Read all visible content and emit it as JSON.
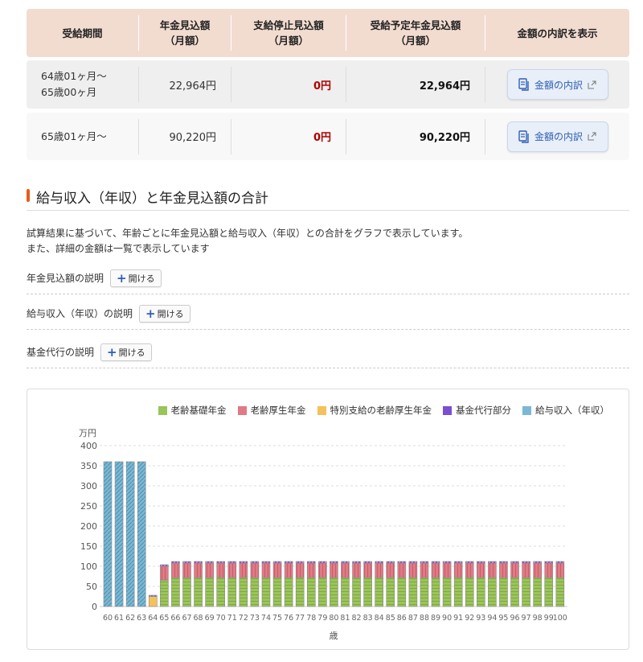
{
  "table": {
    "headers": [
      "受給期間",
      "年金見込額\n（月額）",
      "支給停止見込額\n（月額）",
      "受給予定年金見込額\n（月額）",
      "金額の内訳を表示"
    ],
    "header_lines": [
      [
        "受給期間"
      ],
      [
        "年金見込額",
        "（月額）"
      ],
      [
        "支給停止見込額",
        "（月額）"
      ],
      [
        "受給予定年金見込額",
        "（月額）"
      ],
      [
        "金額の内訳を表示"
      ]
    ],
    "rows": [
      {
        "period_lines": [
          "64歳01ヶ月〜",
          "65歳00ヶ月"
        ],
        "amount": "22,964円",
        "stopped": "0円",
        "scheduled": "22,964円",
        "button": "金額の内訳"
      },
      {
        "period_lines": [
          "65歳01ヶ月〜"
        ],
        "amount": "90,220円",
        "stopped": "0円",
        "scheduled": "90,220円",
        "button": "金額の内訳"
      }
    ]
  },
  "section": {
    "title": "給与収入（年収）と年金見込額の合計",
    "desc1": "試算結果に基づいて、年齢ごとに年金見込額と給与収入（年収）との合計をグラフで表示しています。",
    "desc2": "また、詳細の金額は一覧で表示しています",
    "accordions": [
      {
        "label": "年金見込額の説明",
        "button": "開ける"
      },
      {
        "label": "給与収入（年収）の説明",
        "button": "開ける"
      },
      {
        "label": "基金代行の説明",
        "button": "開ける"
      }
    ]
  },
  "colors": {
    "accent": "#e85a1b",
    "basic": "#9bc45a",
    "employee": "#e07a85",
    "special": "#f5c15a",
    "fund": "#7a4fd0",
    "salary": "#7ab8d4",
    "zero_red": "#b00000"
  },
  "chart_data": {
    "type": "bar",
    "stacked": true,
    "ylabel": "万円",
    "xlabel": "歳",
    "ylim": [
      0,
      400
    ],
    "yticks": [
      0,
      50,
      100,
      150,
      200,
      250,
      300,
      350,
      400
    ],
    "grid": true,
    "legend_position": "top-right",
    "categories": [
      "60",
      "61",
      "62",
      "63",
      "64",
      "65",
      "66",
      "67",
      "68",
      "69",
      "70",
      "71",
      "72",
      "73",
      "74",
      "75",
      "76",
      "77",
      "78",
      "79",
      "80",
      "81",
      "82",
      "83",
      "84",
      "85",
      "86",
      "87",
      "88",
      "89",
      "90",
      "91",
      "92",
      "93",
      "94",
      "95",
      "96",
      "97",
      "98",
      "99",
      "100"
    ],
    "series": [
      {
        "name": "老齢基礎年金",
        "color": "#9bc45a",
        "values": [
          0,
          0,
          0,
          0,
          0,
          66,
          72,
          72,
          72,
          72,
          72,
          72,
          72,
          72,
          72,
          72,
          72,
          72,
          72,
          72,
          72,
          72,
          72,
          72,
          72,
          72,
          72,
          72,
          72,
          72,
          72,
          72,
          72,
          72,
          72,
          72,
          72,
          72,
          72,
          72,
          72
        ]
      },
      {
        "name": "老齢厚生年金",
        "color": "#e07a85",
        "values": [
          0,
          0,
          0,
          0,
          0,
          34,
          36,
          36,
          36,
          36,
          36,
          36,
          36,
          36,
          36,
          36,
          36,
          36,
          36,
          36,
          36,
          36,
          36,
          36,
          36,
          36,
          36,
          36,
          36,
          36,
          36,
          36,
          36,
          36,
          36,
          36,
          36,
          36,
          36,
          36,
          36
        ]
      },
      {
        "name": "特別支給の老齢厚生年金",
        "color": "#f5c15a",
        "values": [
          0,
          0,
          0,
          0,
          25,
          0,
          0,
          0,
          0,
          0,
          0,
          0,
          0,
          0,
          0,
          0,
          0,
          0,
          0,
          0,
          0,
          0,
          0,
          0,
          0,
          0,
          0,
          0,
          0,
          0,
          0,
          0,
          0,
          0,
          0,
          0,
          0,
          0,
          0,
          0,
          0
        ]
      },
      {
        "name": "基金代行部分",
        "color": "#7a4fd0",
        "values": [
          0,
          0,
          0,
          0,
          3,
          4,
          4,
          4,
          4,
          4,
          4,
          4,
          4,
          4,
          4,
          4,
          4,
          4,
          4,
          4,
          4,
          4,
          4,
          4,
          4,
          4,
          4,
          4,
          4,
          4,
          4,
          4,
          4,
          4,
          4,
          4,
          4,
          4,
          4,
          4,
          4
        ]
      },
      {
        "name": "給与収入（年収）",
        "color": "#7ab8d4",
        "values": [
          360,
          360,
          360,
          360,
          0,
          0,
          0,
          0,
          0,
          0,
          0,
          0,
          0,
          0,
          0,
          0,
          0,
          0,
          0,
          0,
          0,
          0,
          0,
          0,
          0,
          0,
          0,
          0,
          0,
          0,
          0,
          0,
          0,
          0,
          0,
          0,
          0,
          0,
          0,
          0,
          0
        ]
      }
    ]
  }
}
